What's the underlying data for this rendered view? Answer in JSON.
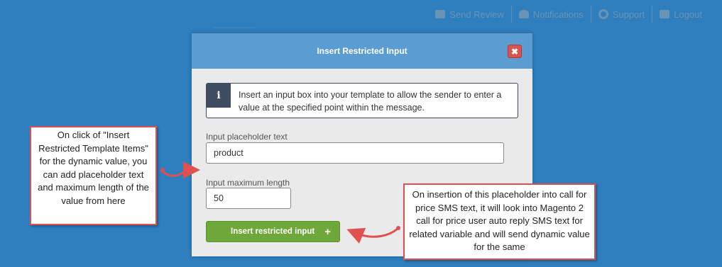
{
  "topnav": {
    "items": [
      {
        "label": "Send Review",
        "icon": "envelope-icon"
      },
      {
        "label": "Notifications",
        "icon": "bell-icon"
      },
      {
        "label": "Support",
        "icon": "lifebuoy-icon"
      },
      {
        "label": "Logout",
        "icon": "logout-icon"
      }
    ]
  },
  "modal": {
    "title": "Insert Restricted Input",
    "close_label": "✖",
    "info_icon": "i",
    "info_text": "Insert an input box into your template to allow the sender to enter a value at the specified point within the message.",
    "placeholder_label": "Input placeholder text",
    "placeholder_value": "product",
    "maxlength_label": "Input maximum length",
    "maxlength_value": "50",
    "insert_button": "Insert restricted input",
    "insert_button_icon": "+"
  },
  "annotations": {
    "left": "On click of \"Insert Restricted Template Items\" for the dynamic value, you can add placeholder text and maximum length of the value from here",
    "right": "On insertion of this placeholder into call for price SMS text, it will look into Magento 2 call for price user auto reply SMS text for related variable and will send dynamic value for the same"
  },
  "colors": {
    "background": "#2f7fbf",
    "modal_header": "#5b9dd0",
    "button_green": "#6fa83a",
    "close_red": "#d9534f",
    "annotation_border": "#e05050"
  }
}
